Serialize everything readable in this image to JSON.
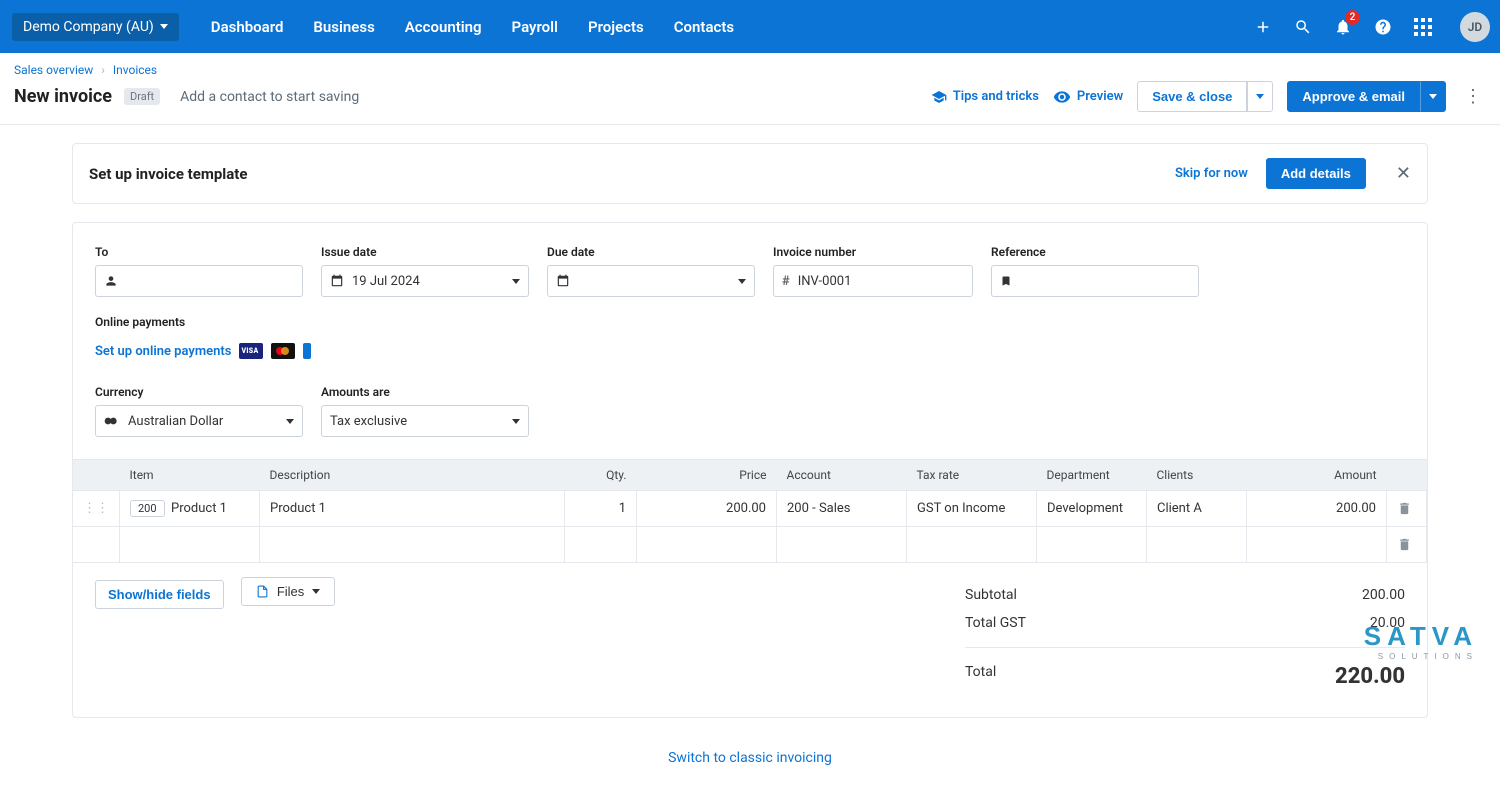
{
  "topbar": {
    "company": "Demo Company (AU)",
    "nav": [
      "Dashboard",
      "Business",
      "Accounting",
      "Payroll",
      "Projects",
      "Contacts"
    ],
    "notif_count": "2",
    "avatar_initials": "JD"
  },
  "breadcrumb": {
    "a": "Sales overview",
    "b": "Invoices"
  },
  "page": {
    "title": "New invoice",
    "draft_label": "Draft",
    "hint": "Add a contact to start saving",
    "tips": "Tips and tricks",
    "preview": "Preview",
    "save": "Save & close",
    "approve": "Approve & email"
  },
  "banner": {
    "title": "Set up invoice template",
    "skip": "Skip for now",
    "add_details": "Add details"
  },
  "form": {
    "labels": {
      "to": "To",
      "issue": "Issue date",
      "due": "Due date",
      "inv_no": "Invoice number",
      "ref": "Reference",
      "online": "Online payments",
      "currency": "Currency",
      "amounts": "Amounts are"
    },
    "values": {
      "issue_date": "19 Jul 2024",
      "inv_no": "INV-0001",
      "currency": "Australian Dollar",
      "amounts": "Tax exclusive",
      "online_cta": "Set up online payments"
    }
  },
  "table": {
    "headers": {
      "item": "Item",
      "desc": "Description",
      "qty": "Qty.",
      "price": "Price",
      "account": "Account",
      "tax": "Tax rate",
      "dept": "Department",
      "clients": "Clients",
      "amount": "Amount"
    },
    "row1": {
      "code": "200",
      "item": "Product 1",
      "desc": "Product 1",
      "qty": "1",
      "price": "200.00",
      "account": "200 - Sales",
      "tax": "GST on Income",
      "dept": "Development",
      "clients": "Client A",
      "amount": "200.00"
    }
  },
  "below": {
    "showhide": "Show/hide fields",
    "files": "Files"
  },
  "totals": {
    "subtotal_label": "Subtotal",
    "subtotal": "200.00",
    "gst_label": "Total GST",
    "gst": "20.00",
    "total_label": "Total",
    "total": "220.00"
  },
  "footer": {
    "switch": "Switch to classic invoicing"
  },
  "watermark": {
    "big": "SATVA",
    "small": "SOLUTIONS"
  }
}
